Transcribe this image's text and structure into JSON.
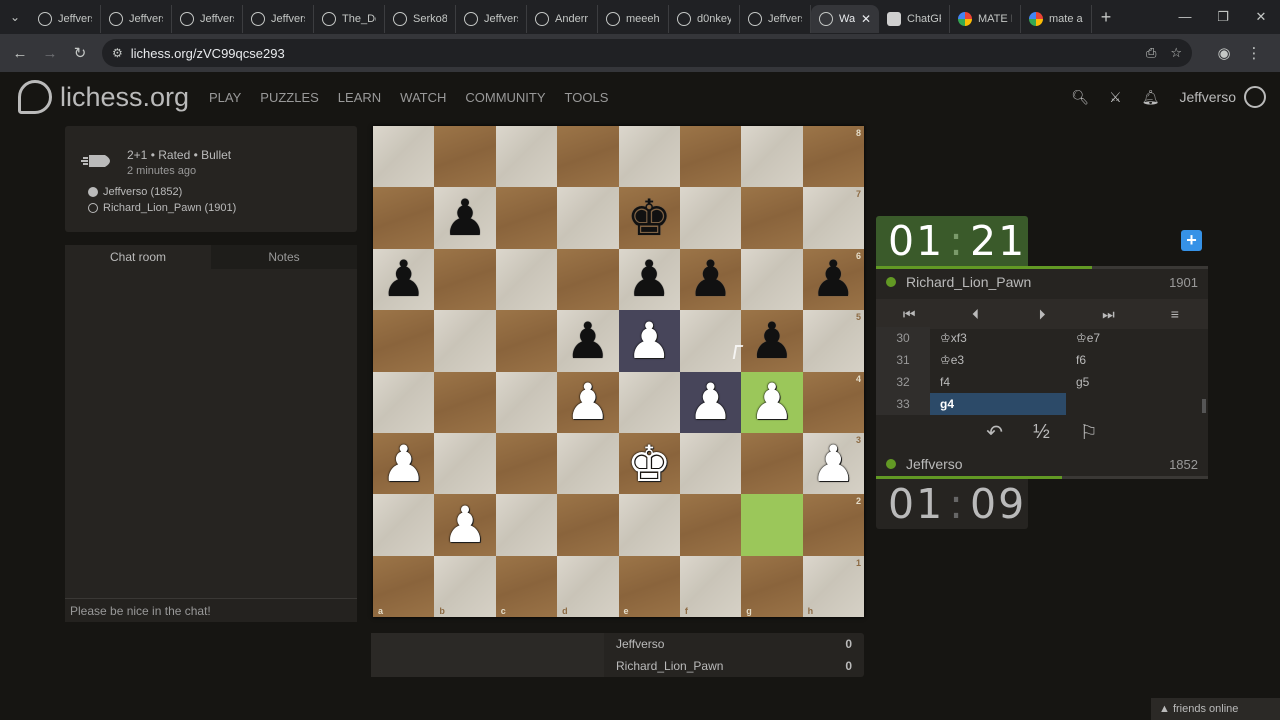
{
  "browser": {
    "tabs": [
      {
        "label": "Jeffvers",
        "icon": "lichess-icon",
        "active": false
      },
      {
        "label": "Jeffvers",
        "icon": "lichess-icon",
        "active": false
      },
      {
        "label": "Jeffvers",
        "icon": "lichess-icon",
        "active": false
      },
      {
        "label": "Jeffvers",
        "icon": "lichess-icon",
        "active": false
      },
      {
        "label": "The_Dc",
        "icon": "lichess-icon",
        "active": false
      },
      {
        "label": "Serko8",
        "icon": "lichess-icon",
        "active": false
      },
      {
        "label": "Jeffvers",
        "icon": "lichess-icon",
        "active": false
      },
      {
        "label": "Anderr",
        "icon": "lichess-icon",
        "active": false
      },
      {
        "label": "meeeh",
        "icon": "lichess-icon",
        "active": false
      },
      {
        "label": "d0nkey",
        "icon": "lichess-icon",
        "active": false
      },
      {
        "label": "Jeffvers",
        "icon": "lichess-icon",
        "active": false
      },
      {
        "label": "Wa",
        "icon": "lichess-icon",
        "active": true
      },
      {
        "label": "ChatGF",
        "icon": "chatgpt-icon",
        "active": false
      },
      {
        "label": "MATE I",
        "icon": "google-icon",
        "active": false
      },
      {
        "label": "mate a",
        "icon": "google-icon",
        "active": false
      }
    ],
    "url": "lichess.org/zVC99qcse293"
  },
  "header": {
    "logo_text": "lichess.org",
    "nav": [
      "PLAY",
      "PUZZLES",
      "LEARN",
      "WATCH",
      "COMMUNITY",
      "TOOLS"
    ],
    "username": "Jeffverso"
  },
  "game_info": {
    "line1": "2+1 • Rated • Bullet",
    "line2": "2 minutes ago",
    "white_player": "Jeffverso (1852)",
    "black_player": "Richard_Lion_Pawn (1901)"
  },
  "chat": {
    "tabs": [
      "Chat room",
      "Notes"
    ],
    "placeholder": "Please be nice in the chat!"
  },
  "board": {
    "ranks": [
      "8",
      "7",
      "6",
      "5",
      "4",
      "3",
      "2",
      "1"
    ],
    "files": [
      "a",
      "b",
      "c",
      "d",
      "e",
      "f",
      "g",
      "h"
    ],
    "rows": [
      "........",
      ".p..k...",
      "p...pp.p",
      "...pP.p.",
      "...P.PP.",
      "P...K..P",
      ".P......",
      "........"
    ],
    "last_move": [
      "g2",
      "g4"
    ],
    "dark_highlight": [
      "e5",
      "f4"
    ]
  },
  "opponent": {
    "name": "Richard_Lion_Pawn",
    "rating": "1901",
    "clock_min": "01",
    "clock_sec": "21",
    "time_fraction": 0.65
  },
  "player": {
    "name": "Jeffverso",
    "rating": "1852",
    "clock_min": "01",
    "clock_sec": "09",
    "time_fraction": 0.56
  },
  "moves": [
    {
      "n": "30",
      "white": "♔xf3",
      "black": "♔e7"
    },
    {
      "n": "31",
      "white": "♔e3",
      "black": "f6"
    },
    {
      "n": "32",
      "white": "f4",
      "black": "g5"
    },
    {
      "n": "33",
      "white": "g4",
      "black": ""
    }
  ],
  "crosstable": [
    {
      "name": "Jeffverso",
      "score": "0"
    },
    {
      "name": "Richard_Lion_Pawn",
      "score": "0"
    }
  ],
  "footer": {
    "friends_label": "friends online"
  }
}
